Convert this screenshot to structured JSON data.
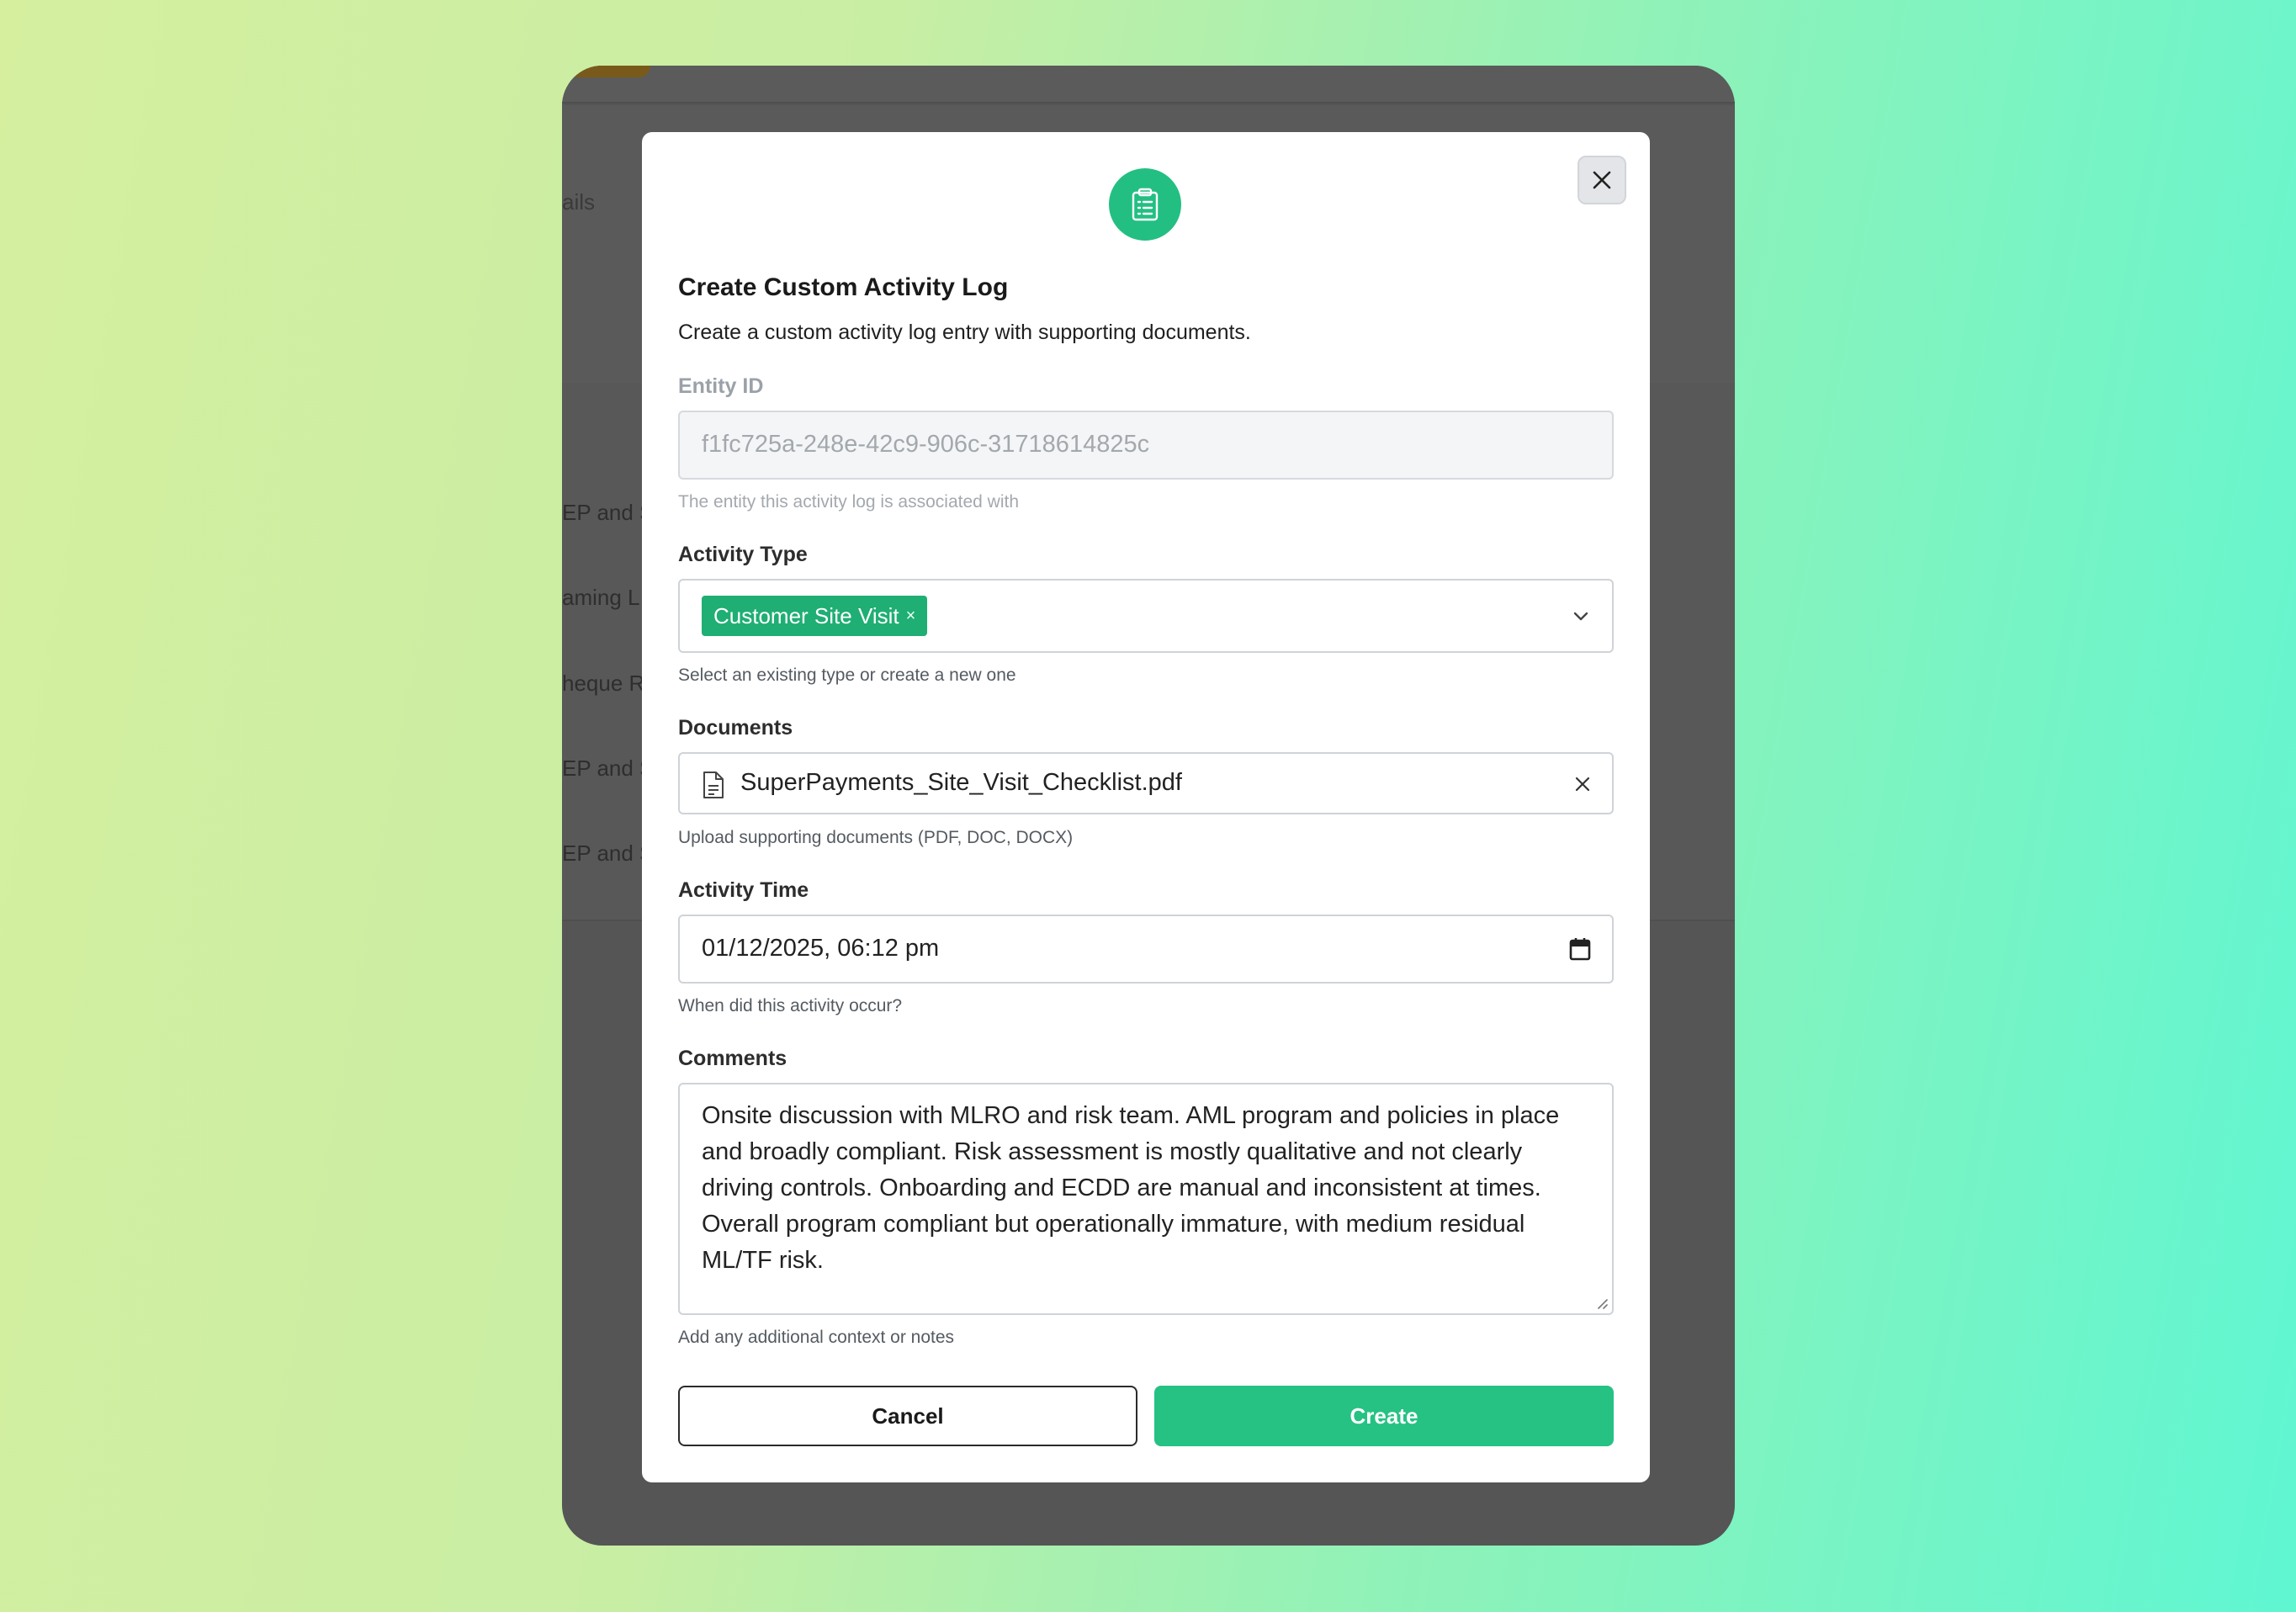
{
  "background": {
    "tab_fragment": "ails",
    "rows": [
      "EP and S",
      "aming L",
      "heque R",
      "EP and S",
      "EP and S"
    ]
  },
  "modal": {
    "icon": "clipboard-list-icon",
    "title": "Create Custom Activity Log",
    "description": "Create a custom activity log entry with supporting documents.",
    "close_icon": "close-icon",
    "entity_id": {
      "label": "Entity ID",
      "value": "f1fc725a-248e-42c9-906c-31718614825c",
      "help": "The entity this activity log is associated with"
    },
    "activity_type": {
      "label": "Activity Type",
      "selected": "Customer Site Visit",
      "chip_remove": "×",
      "help": "Select an existing type or create a new one"
    },
    "documents": {
      "label": "Documents",
      "file_name": "SuperPayments_Site_Visit_Checklist.pdf",
      "help": "Upload supporting documents (PDF, DOC, DOCX)"
    },
    "activity_time": {
      "label": "Activity Time",
      "value": "01/12/2025, 06:12 pm",
      "help": "When did this activity occur?"
    },
    "comments": {
      "label": "Comments",
      "value": "Onsite discussion with MLRO and risk team. AML program and policies in place and broadly compliant. Risk assessment is mostly qualitative and not clearly driving controls. Onboarding and ECDD are manual and inconsistent at times. Overall program compliant but operationally immature, with medium residual ML/TF risk.",
      "help": "Add any additional context or notes"
    },
    "buttons": {
      "cancel": "Cancel",
      "create": "Create"
    }
  },
  "colors": {
    "accent": "#23bf82",
    "chip": "#1fae73",
    "overlay": "#555555"
  }
}
